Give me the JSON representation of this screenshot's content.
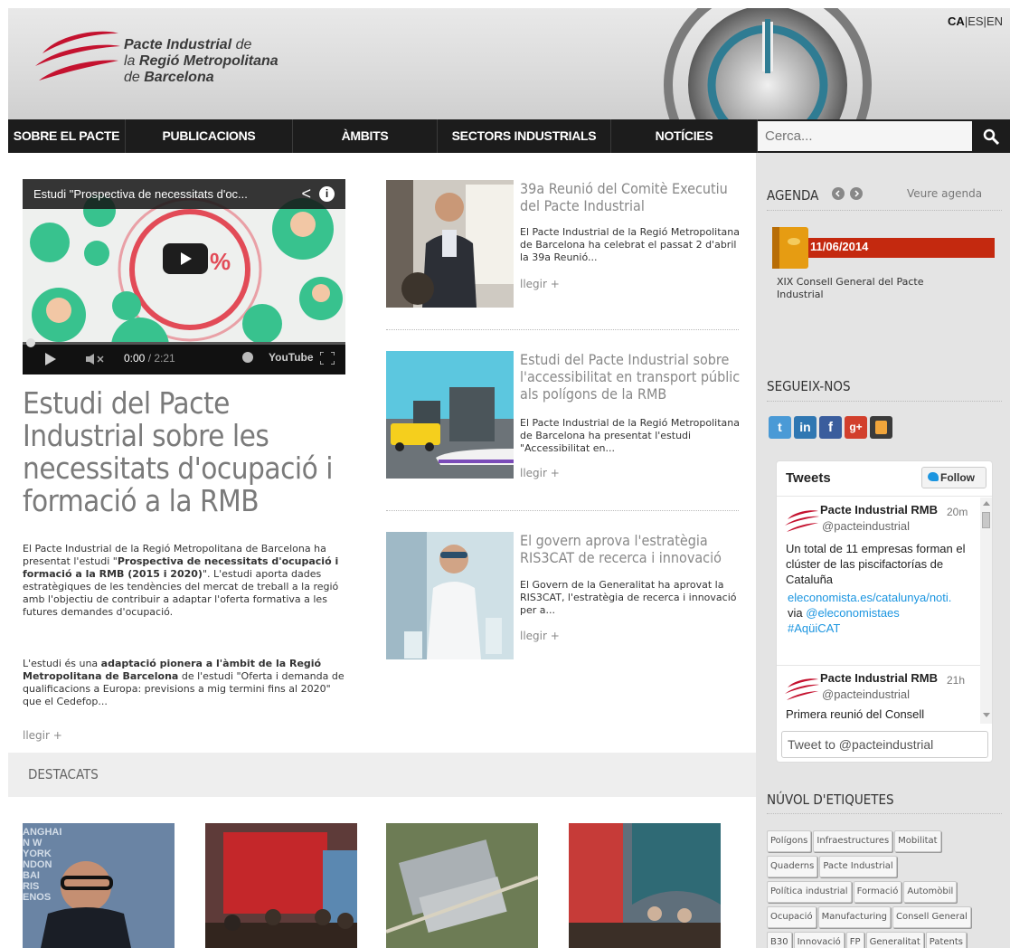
{
  "header": {
    "org_name_line1_a": "Pacte Industrial",
    "org_name_line1_b": "de",
    "org_name_line2_a": "la",
    "org_name_line2_b": "Regió Metropolitana",
    "org_name_line3_a": "de",
    "org_name_line3_b": "Barcelona",
    "lang_ca": "CA",
    "lang_sep1": "|",
    "lang_es": "ES",
    "lang_sep2": "|",
    "lang_en": "EN"
  },
  "nav": {
    "items": [
      {
        "label": "SOBRE EL PACTE"
      },
      {
        "label": "PUBLICACIONS"
      },
      {
        "label": "ÀMBITS"
      },
      {
        "label": "SECTORS INDUSTRIALS"
      },
      {
        "label": "NOTÍCIES"
      }
    ],
    "search_placeholder": "Cerca..."
  },
  "video": {
    "title": "Estudi \"Prospectiva de necessitats d'oc...",
    "time_current": "0:00",
    "time_sep": " / ",
    "time_total": "2:21",
    "youtube_label": "YouTube",
    "overlay_text": "%"
  },
  "lead": {
    "title": "Estudi del Pacte Industrial sobre les necessitats d'ocupació i formació a la RMB",
    "p1_a": "El Pacte Industrial de la Regió Metropolitana de Barcelona ha presentat l'estudi \"",
    "p1_b": "Prospectiva de necessitats d'ocupació i formació a la RMB (2015 i 2020)",
    "p1_c": "\". L'estudi aporta dades estratègiques de les tendències del mercat de treball a la regió amb l'objectiu de contribuir a adaptar l'oferta formativa a les futures demandes d'ocupació.",
    "p2_a": "L'estudi és una ",
    "p2_b": "adaptació pionera a l'àmbit de la Regió Metropolitana de Barcelona",
    "p2_c": " de l'estudi \"Oferta i demanda de qualificacions a Europa: previsions a mig termini fins al 2020\" que el Cedefop...",
    "more": "llegir +"
  },
  "news": [
    {
      "title": "39a Reunió del Comitè Executiu del Pacte Industrial",
      "text": "El Pacte Industrial de la Regió Metropolitana de Barcelona ha celebrat el passat 2 d'abril la 39a Reunió...",
      "more": "llegir +"
    },
    {
      "title": "Estudi del Pacte Industrial sobre l'accessibilitat en transport públic als polígons de la RMB",
      "text": "El Pacte Industrial de la Regió Metropolitana de Barcelona ha presentat l'estudi \"Accessibilitat en...",
      "more": "llegir +"
    },
    {
      "title": "El govern aprova l'estratègia RIS3CAT de recerca i innovació",
      "text": "El Govern de la Generalitat ha aprovat la RIS3CAT, l'estratègia de recerca i innovació per a...",
      "more": "llegir +"
    }
  ],
  "destacats": {
    "label": "DESTACATS",
    "thumb1_text": "ANGHAI N W YORK NDON BAI RIS ENOS"
  },
  "sidebar": {
    "agenda_title": "AGENDA",
    "agenda_link": "Veure agenda",
    "event_date": "11/06/2014",
    "event_title": "XIX Consell General del Pacte Industrial",
    "follow_title": "SEGUEIX-NOS",
    "tags_title": "NÚVOL D'ETIQUETES",
    "tags": [
      "Polígons",
      "Infraestructures",
      "Mobilitat",
      "Quaderns",
      "Pacte Industrial",
      "Política industrial",
      "Formació",
      "Automòbil",
      "Ocupació",
      "Manufacturing",
      "Consell General",
      "B30",
      "Innovació",
      "FP",
      "Generalitat",
      "Patents"
    ]
  },
  "twitter": {
    "header": "Tweets",
    "follow": "Follow",
    "tweets": [
      {
        "name": "Pacte Industrial RMB",
        "handle": "@pacteindustrial",
        "time": "20m",
        "text": "Un total de 11 empresas forman el clúster de las piscifactorías de Cataluña",
        "link": "eleconomista.es/catalunya/noti.",
        "via": "via",
        "via_handle": "@eleconomistaes",
        "hashtag": "#AqüiCAT"
      },
      {
        "name": "Pacte Industrial RMB",
        "handle": "@pacteindustrial",
        "time": "21h",
        "text": "Primera reunió del Consell"
      }
    ],
    "compose_placeholder": "Tweet to @pacteindustrial"
  },
  "colors": {
    "nav_bg": "#1c1c1c",
    "brand_red": "#c4122f",
    "sidebar_bg": "#e4e4e4",
    "agenda_bar": "#c4290f",
    "twitter_blue": "#1b95e0"
  }
}
